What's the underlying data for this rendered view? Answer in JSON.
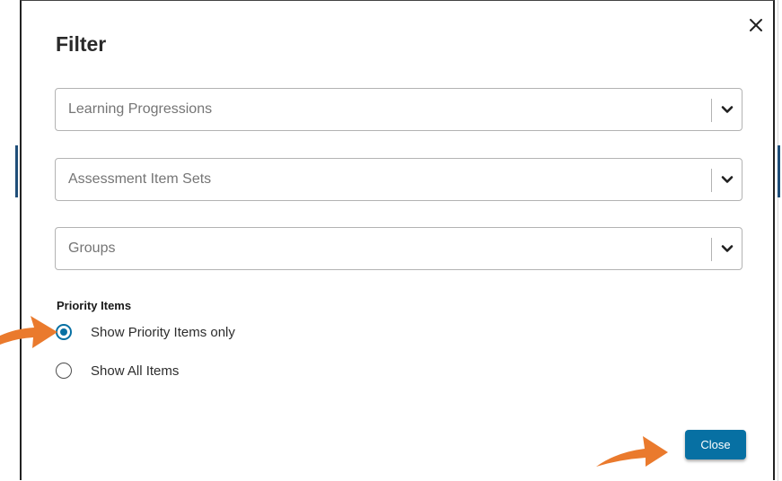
{
  "modal": {
    "title": "Filter",
    "close_icon": "close-icon"
  },
  "filters": [
    {
      "placeholder": "Learning Progressions"
    },
    {
      "placeholder": "Assessment Item Sets"
    },
    {
      "placeholder": "Groups"
    }
  ],
  "priority": {
    "label": "Priority Items",
    "options": [
      {
        "label": "Show Priority Items only",
        "selected": true
      },
      {
        "label": "Show All Items",
        "selected": false
      }
    ]
  },
  "footer": {
    "close_label": "Close"
  },
  "colors": {
    "accent": "#0770a3",
    "annotation_arrow": "#ea7a2d"
  }
}
